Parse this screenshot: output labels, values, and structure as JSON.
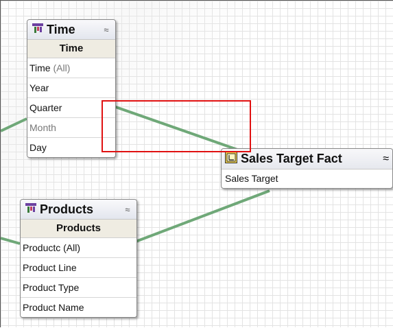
{
  "time_dimension": {
    "title": "Time",
    "hierarchy": "Time",
    "collapse_glyph": "≈",
    "levels": [
      {
        "label": "Time ",
        "suffix": "(All)"
      },
      {
        "label": "Year"
      },
      {
        "label": "Quarter"
      },
      {
        "label": "Month"
      },
      {
        "label": "Day"
      }
    ]
  },
  "products_dimension": {
    "title": "Products",
    "hierarchy": "Products",
    "collapse_glyph": "≈",
    "levels": [
      "Productc (All)",
      "Product Line",
      "Product Type",
      "Product Name"
    ]
  },
  "fact": {
    "title": "Sales Target Fact",
    "collapse_glyph": "≈",
    "measures": [
      "Sales Target"
    ]
  },
  "colors": {
    "link": "#6fa878",
    "highlight": "#e01010",
    "dim_icon": "#6b3fa0",
    "fact_icon": "#d4b020"
  },
  "icons": {
    "dimension": "hierarchy-icon",
    "fact": "fact-table-icon"
  }
}
